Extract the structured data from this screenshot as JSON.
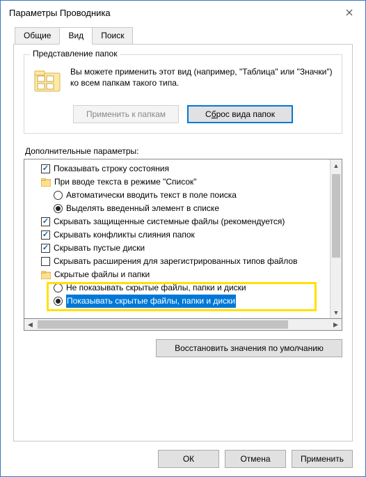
{
  "window": {
    "title": "Параметры Проводника"
  },
  "tabs": {
    "general": "Общие",
    "view": "Вид",
    "search": "Поиск"
  },
  "folderViews": {
    "legend": "Представление папок",
    "description": "Вы можете применить этот вид (например, \"Таблица\" или \"Значки\") ко всем папкам такого типа.",
    "applyBtn": "Применить к папкам",
    "resetBtn_pre": "С",
    "resetBtn_u": "б",
    "resetBtn_post": "рос вида папок"
  },
  "advanced": {
    "label": "Дополнительные параметры:",
    "items": {
      "showStatusBar": "Показывать строку состояния",
      "onTypeInList": "При вводе текста в режиме \"Список\"",
      "autoTypeSearch": "Автоматически вводить текст в поле поиска",
      "selectTyped": "Выделять введенный элемент в списке",
      "hideProtectedOS": "Скрывать защищенные системные файлы (рекомендуется)",
      "hideMergeConflicts": "Скрывать конфликты слияния папок",
      "hideEmptyDrives": "Скрывать пустые диски",
      "hideExtensions": "Скрывать расширения для зарегистрированных типов файлов",
      "hiddenFilesFolders": "Скрытые файлы и папки",
      "dontShowHidden": "Не показывать скрытые файлы, папки и диски",
      "showHidden": "Показывать скрытые файлы, папки и диски"
    },
    "restoreDefaults": "Восстановить значения по умолчанию"
  },
  "dialog": {
    "ok": "ОК",
    "cancel": "Отмена",
    "apply": "Применить"
  }
}
